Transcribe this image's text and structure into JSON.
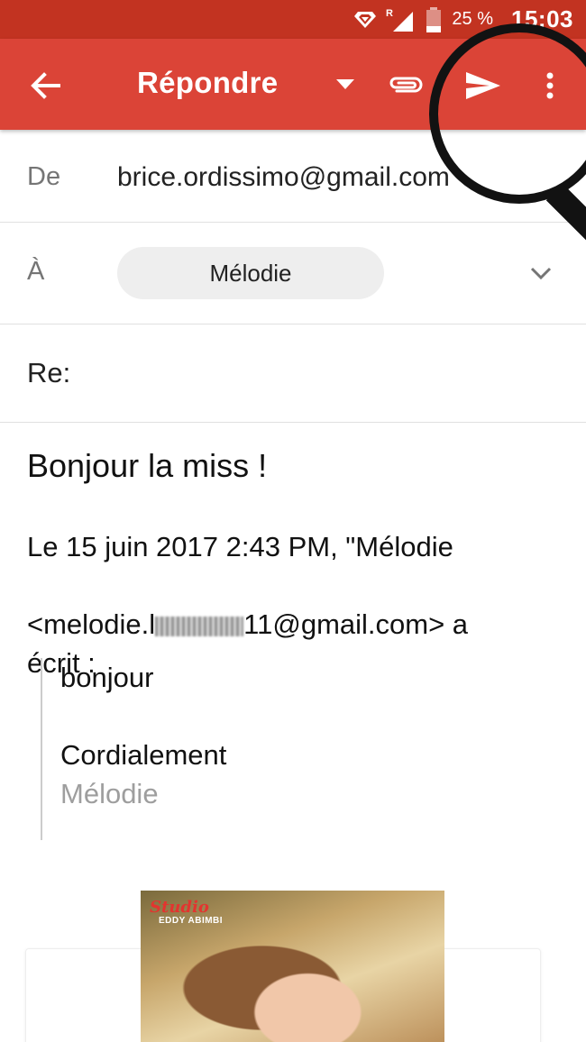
{
  "status_bar": {
    "battery": "25 %",
    "time": "15:03"
  },
  "app_bar": {
    "title": "Répondre"
  },
  "compose": {
    "from_label": "De",
    "from_value": "brice.ordissimo@gmail.com",
    "to_label": "À",
    "recipient": "Mélodie",
    "subject": "Re:",
    "body": "Bonjour la miss !"
  },
  "quoted": {
    "header_line1": "Le 15 juin 2017 2:43 PM, \"Mélodie",
    "email_prefix": "<melodie.l",
    "email_suffix": "11@gmail.com> a",
    "header_line3": "écrit :",
    "text1": "bonjour",
    "text2": "Cordialement",
    "signature": "Mélodie"
  },
  "attachment": {
    "studio_name": "Studio",
    "studio_sub": "EDDY ABIMBI"
  },
  "colors": {
    "status_bar": "#c23321",
    "app_bar": "#db4437",
    "chip": "#eeeeee"
  },
  "icons": {
    "back": "arrow-left-icon",
    "dropdown": "triangle-down-icon",
    "attach": "paperclip-icon",
    "send": "send-icon",
    "more": "more-vert-icon",
    "expand": "chevron-down-icon"
  }
}
